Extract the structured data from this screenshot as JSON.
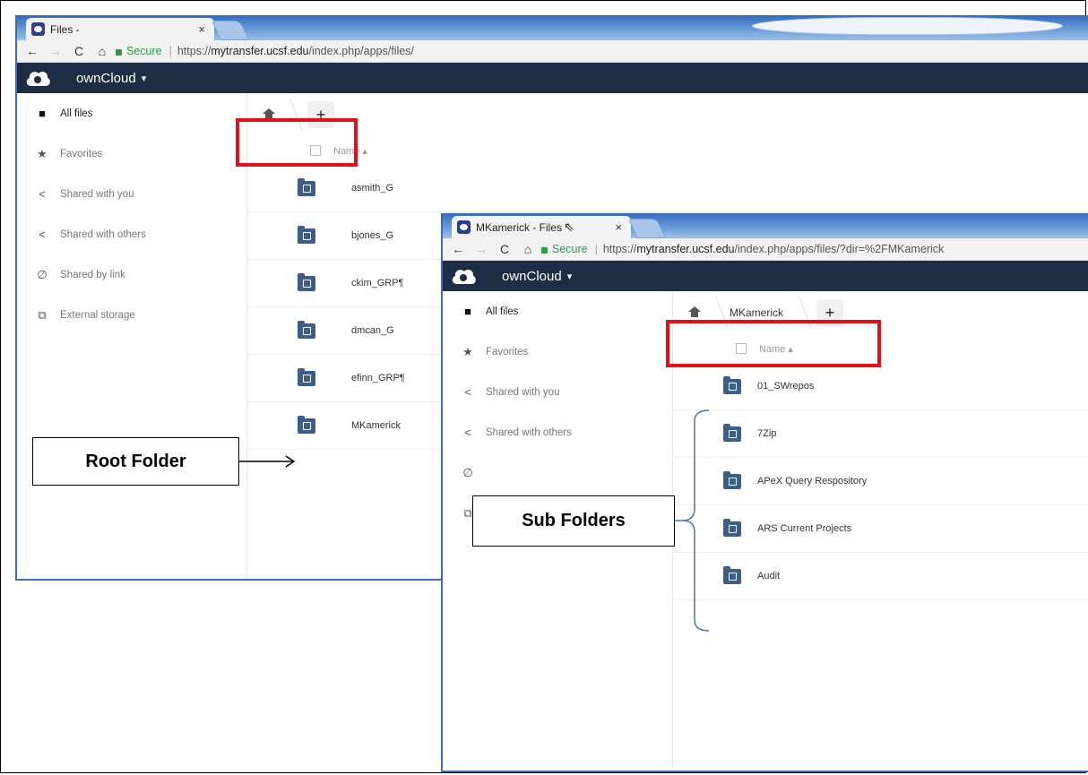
{
  "back_window": {
    "tab_title": "Files -",
    "tab_close": "×",
    "url_secure": "Secure",
    "url_prefix": "https://",
    "url_domain": "mytransfer.ucsf.edu",
    "url_path": "/index.php/apps/files/",
    "brand": "ownCloud",
    "brand_caret": "▾",
    "sidebar": [
      {
        "label": "All files",
        "icon": "folder-icon",
        "glyph": "■"
      },
      {
        "label": "Favorites",
        "icon": "star-icon",
        "glyph": "★"
      },
      {
        "label": "Shared with you",
        "icon": "share-icon",
        "glyph": "<"
      },
      {
        "label": "Shared with others",
        "icon": "share-icon",
        "glyph": "<"
      },
      {
        "label": "Shared by link",
        "icon": "link-icon",
        "glyph": "🔗"
      },
      {
        "label": "External storage",
        "icon": "external-icon",
        "glyph": "⧉"
      }
    ],
    "breadcrumb_add": "+",
    "column_name": "Name ▴",
    "files": [
      "asmith_G",
      "bjones_G",
      "ckim_GRP¶",
      "dmcan_G",
      "efinn_GRP¶",
      "MKamerick"
    ]
  },
  "front_window": {
    "tab_title": "MKamerick - Files",
    "tab_close": "×",
    "url_secure": "Secure",
    "url_prefix": "https://",
    "url_domain": "mytransfer.ucsf.edu",
    "url_path": "/index.php/apps/files/?dir=%2FMKamerick",
    "brand": "ownCloud",
    "brand_caret": "▾",
    "sidebar": [
      {
        "label": "All files",
        "icon": "folder-icon",
        "glyph": "■"
      },
      {
        "label": "Favorites",
        "icon": "star-icon",
        "glyph": "★"
      },
      {
        "label": "Shared with you",
        "icon": "share-icon",
        "glyph": "<"
      },
      {
        "label": "Shared with others",
        "icon": "share-icon",
        "glyph": "<"
      }
    ],
    "breadcrumb_folder": "MKamerick",
    "breadcrumb_add": "+",
    "column_name": "Name ▴",
    "files": [
      "01_SWrepos",
      "7Zip",
      "APeX Query Respository",
      "ARS Current Projects",
      "Audit"
    ]
  },
  "annotations": {
    "root_folder": "Root Folder",
    "sub_folders": "Sub Folders"
  },
  "colors": {
    "annotation_red": "#e3101b",
    "topbar": "#1d2d44",
    "folder_icon": "#3d5d8a",
    "secure_green": "#2e9b46"
  }
}
